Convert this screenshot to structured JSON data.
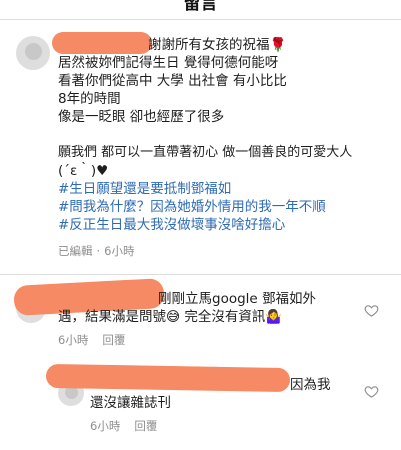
{
  "header": {
    "title": "留言"
  },
  "main_comment": {
    "lines": [
      "謝謝所有女孩的祝福🌹",
      "居然被妳們記得生日 覺得何德何能呀",
      "看著你們從高中 大學 出社會 有小比比",
      "8年的時間",
      "像是一眨眼 卻也經歷了很多",
      "",
      "願我們 都可以一直帶著初心 做一個善良的可愛大人",
      "(´ε｀)♥",
      "#生日願望還是要抵制鄧福如",
      "#問我為什麼？因為她婚外情用的我一年不順",
      "#反正生日最大我沒做壞事沒啥好擔心"
    ],
    "meta": {
      "edited": "已編輯",
      "separator": "·",
      "time": "6小時"
    }
  },
  "reply_1": {
    "lines": [
      "剛剛立馬google 鄧福如外",
      "遇，結果滿是問號😅  完全沒有資訊🤷‍♀️"
    ],
    "meta": {
      "time": "6小時",
      "reply_label": "回覆"
    }
  },
  "reply_2": {
    "lines": [
      "因為我",
      "還沒讓雜誌刊"
    ],
    "meta": {
      "time": "6小時",
      "reply_label": "回覆"
    }
  },
  "icons": {
    "like": "heart-icon",
    "avatar": "avatar"
  },
  "colors": {
    "hashtag": "#2f6bb3",
    "redaction": "#f58a64",
    "meta": "#8e8e8e"
  }
}
